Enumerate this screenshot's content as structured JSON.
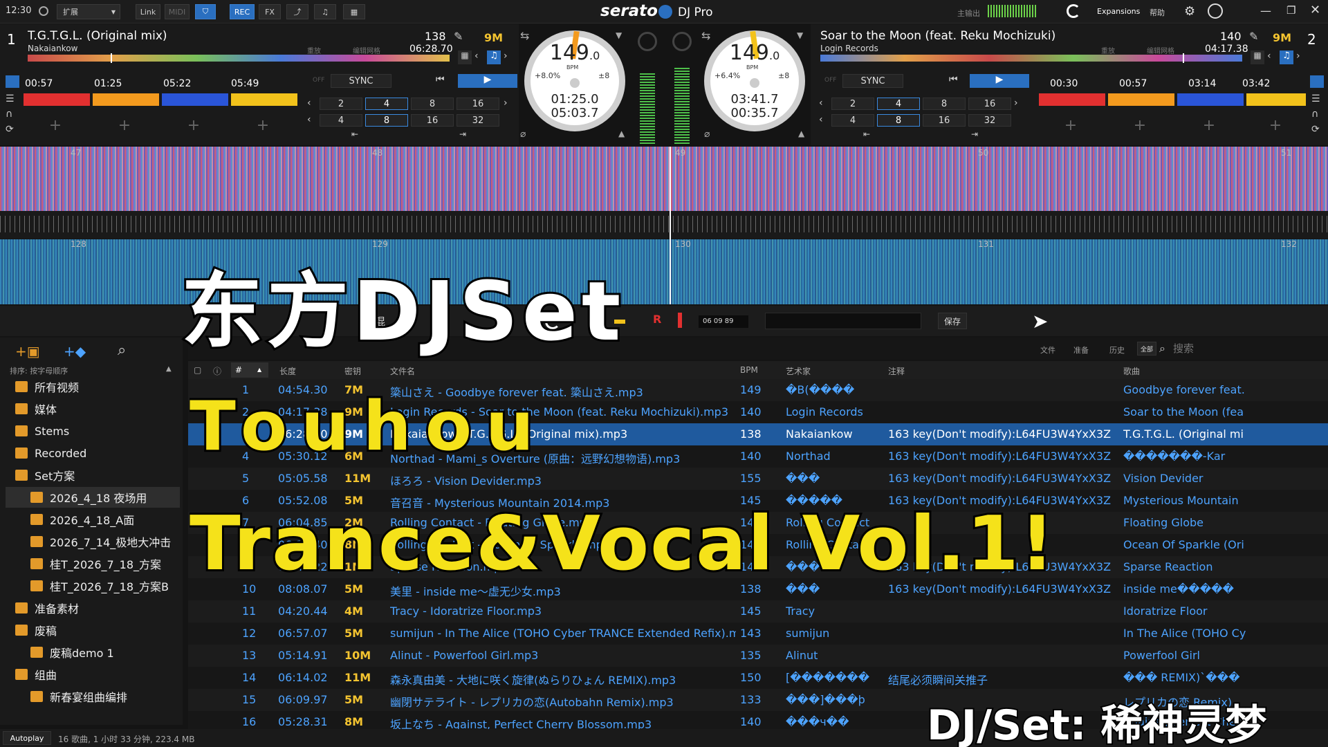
{
  "topbar": {
    "clock": "12:30",
    "mode": "扩展",
    "link": "Link",
    "midi": "MIDI",
    "rec": "REC",
    "fx": "FX",
    "brand": "serato",
    "brand_sub": "DJ Pro",
    "master_out": "主输出",
    "expansions": "Expansions",
    "help": "帮助"
  },
  "deck1": {
    "num": "1",
    "title": "T.G.T.G.L. (Original mix)",
    "artist": "Nakaiankow",
    "bpm": "138",
    "remain": "06:28.70",
    "key": "9M",
    "label_center": "重放",
    "label_grid": "编辑网格",
    "cues": [
      "00:57",
      "01:25",
      "05:22",
      "05:49"
    ],
    "sync": "SYNC",
    "off": "OFF",
    "loops1": [
      "2",
      "4",
      "8",
      "16"
    ],
    "loops2": [
      "4",
      "8",
      "16",
      "32"
    ],
    "platter_bpm": "149",
    "platter_bpm_dec": ".0",
    "platter_bpm_label": "BPM",
    "pitch": "+8.0%",
    "range": "±8",
    "elapsed": "01:25.0",
    "remaining": "05:03.7"
  },
  "deck2": {
    "num": "2",
    "title": "Soar to the Moon (feat. Reku Mochizuki)",
    "artist": "Login Records",
    "bpm": "140",
    "remain": "04:17.38",
    "key": "9M",
    "label_center": "重放",
    "label_grid": "编辑网格",
    "cues": [
      "00:30",
      "00:57",
      "03:14",
      "03:42"
    ],
    "sync": "SYNC",
    "off": "OFF",
    "loops1": [
      "2",
      "4",
      "8",
      "16"
    ],
    "loops2": [
      "4",
      "8",
      "16",
      "32"
    ],
    "platter_bpm": "149",
    "platter_bpm_dec": ".0",
    "platter_bpm_label": "BPM",
    "pitch": "+6.4%",
    "range": "±8",
    "elapsed": "03:41.7",
    "remaining": "00:35.7"
  },
  "overview_beats_top": [
    "47",
    "48",
    "49",
    "50",
    "51"
  ],
  "overview_beats_bottom": [
    "128",
    "129",
    "130",
    "131",
    "132"
  ],
  "recorder": {
    "mix": "混",
    "rec_label": "R",
    "time": "06 09 89",
    "save": "保存"
  },
  "library": {
    "search_placeholder": "搜索",
    "tabs": [
      "文件",
      "准备",
      "历史"
    ],
    "all": "全部",
    "sort_label": "排序: 按字母顺序",
    "columns": {
      "num": "#",
      "length": "长度",
      "key": "密钥",
      "file": "文件名",
      "bpm": "BPM",
      "artist": "艺术家",
      "comment": "注释",
      "song": "歌曲"
    },
    "status": "16 歌曲, 1 小时 33 分钟, 223.4 MB",
    "autoplay": "Autoplay",
    "sidebar": [
      {
        "label": "所有视频",
        "indent": 0
      },
      {
        "label": "媒体",
        "indent": 0
      },
      {
        "label": "Stems",
        "indent": 0
      },
      {
        "label": "Recorded",
        "indent": 0
      },
      {
        "label": "Set方案",
        "indent": 0
      },
      {
        "label": "2026_4_18 夜场用",
        "indent": 1
      },
      {
        "label": "2026_4_18_A面",
        "indent": 1
      },
      {
        "label": "2026_7_14_极地大冲击",
        "indent": 1
      },
      {
        "label": "桂T_2026_7_18_方案",
        "indent": 1
      },
      {
        "label": "桂T_2026_7_18_方案B",
        "indent": 1
      },
      {
        "label": "准备素材",
        "indent": 0
      },
      {
        "label": "废稿",
        "indent": 0
      },
      {
        "label": "废稿demo 1",
        "indent": 1
      },
      {
        "label": "组曲",
        "indent": 0
      },
      {
        "label": "新春宴组曲编排",
        "indent": 1
      }
    ],
    "rows": [
      {
        "num": "1",
        "length": "04:54.30",
        "key": "7M",
        "file": "簗山さえ - Goodbye forever feat. 簗山さえ.mp3",
        "bpm": "149",
        "artist": "�B(����",
        "comment": "",
        "song": "Goodbye forever feat."
      },
      {
        "num": "2",
        "length": "04:17.38",
        "key": "9M",
        "file": "Login Records - Soar to the Moon (feat. Reku Mochizuki).mp3",
        "bpm": "140",
        "artist": "Login Records",
        "comment": "",
        "song": "Soar to the Moon (fea"
      },
      {
        "num": "3",
        "length": "06:28.70",
        "key": "9M",
        "file": "Nakaiankow - T.G.T.G.L. (Original mix).mp3",
        "bpm": "138",
        "artist": "Nakaiankow",
        "comment": "163 key(Don't modify):L64FU3W4YxX3Z",
        "song": "T.G.T.G.L. (Original mi"
      },
      {
        "num": "4",
        "length": "05:30.12",
        "key": "6M",
        "file": "Northad - Mami_s Overture (原曲：远野幻想物语).mp3",
        "bpm": "140",
        "artist": "Northad",
        "comment": "163 key(Don't modify):L64FU3W4YxX3Z",
        "song": "�������-Kar"
      },
      {
        "num": "5",
        "length": "05:05.58",
        "key": "11M",
        "file": "ほろろ - Vision Devider.mp3",
        "bpm": "155",
        "artist": "���",
        "comment": "163 key(Don't modify):L64FU3W4YxX3Z",
        "song": "Vision Devider"
      },
      {
        "num": "6",
        "length": "05:52.08",
        "key": "5M",
        "file": "音召音 - Mysterious Mountain 2014.mp3",
        "bpm": "145",
        "artist": "�����",
        "comment": "163 key(Don't modify):L64FU3W4YxX3Z",
        "song": "Mysterious Mountain"
      },
      {
        "num": "7",
        "length": "06:04.85",
        "key": "2M",
        "file": "Rolling Contact - Floating Globe.mp3",
        "bpm": "140",
        "artist": "Rolling Contact",
        "comment": "",
        "song": "Floating Globe"
      },
      {
        "num": "8",
        "length": "06:12.40",
        "key": "8M",
        "file": "Rolling Contact - Ocean Of Sparkle.mp3",
        "bpm": "140",
        "artist": "Rolling Contact",
        "comment": "",
        "song": "Ocean Of Sparkle (Ori"
      },
      {
        "num": "9",
        "length": "05:41.22",
        "key": "1M",
        "file": "Sparse Reaction.mp3",
        "bpm": "145",
        "artist": "���",
        "comment": "163 key(Don't modify):L64FU3W4YxX3Z",
        "song": "Sparse Reaction"
      },
      {
        "num": "10",
        "length": "08:08.07",
        "key": "5M",
        "file": "美里 - inside me～虚无少女.mp3",
        "bpm": "138",
        "artist": "���",
        "comment": "163 key(Don't modify):L64FU3W4YxX3Z",
        "song": "inside me�����"
      },
      {
        "num": "11",
        "length": "04:20.44",
        "key": "4M",
        "file": "Tracy - Idoratrize Floor.mp3",
        "bpm": "145",
        "artist": "Tracy",
        "comment": "",
        "song": "Idoratrize Floor"
      },
      {
        "num": "12",
        "length": "06:57.07",
        "key": "5M",
        "file": "sumijun - In The Alice (TOHO Cyber TRANCE Extended Refix).mp3",
        "bpm": "143",
        "artist": "sumijun",
        "comment": "",
        "song": "In The Alice (TOHO Cy"
      },
      {
        "num": "13",
        "length": "05:14.91",
        "key": "10M",
        "file": "Alinut - Powerfool Girl.mp3",
        "bpm": "135",
        "artist": "Alinut",
        "comment": "",
        "song": "Powerfool Girl"
      },
      {
        "num": "14",
        "length": "06:14.02",
        "key": "11M",
        "file": "森永真由美 - 大地に咲く旋律(ぬらりひょん REMIX).mp3",
        "bpm": "150",
        "artist": "[�������",
        "comment": "结尾必须瞬间关推子",
        "song": "��� REMIX)`���"
      },
      {
        "num": "15",
        "length": "06:09.97",
        "key": "5M",
        "file": "幽閉サテライト - レプリカの恋(Autobahn Remix).mp3",
        "bpm": "133",
        "artist": "���]���þ",
        "comment": "",
        "song": "レプリカの恋 Remix)"
      },
      {
        "num": "16",
        "length": "05:28.31",
        "key": "8M",
        "file": "坂上なち - Against, Perfect Cherry Blossom.mp3",
        "bpm": "140",
        "artist": "���ч��",
        "comment": "",
        "song": "Against, Perfect Cher"
      }
    ]
  },
  "overlay": {
    "title": "东方DJSet",
    "line2": "Touhou",
    "line3": "Trance&Vocal Vol.1!",
    "credit": "DJ/Set: 稀神灵梦"
  },
  "colors": {
    "accent_blue": "#2a6fc0",
    "key_yellow": "#f4c430",
    "cue_red": "#e23030",
    "cue_orange": "#f39a1e",
    "cue_blue": "#2a55d8",
    "cue_yellow": "#f2c21b",
    "overlay_yellow": "#f5e21a",
    "link_blue": "#4da3ff"
  }
}
